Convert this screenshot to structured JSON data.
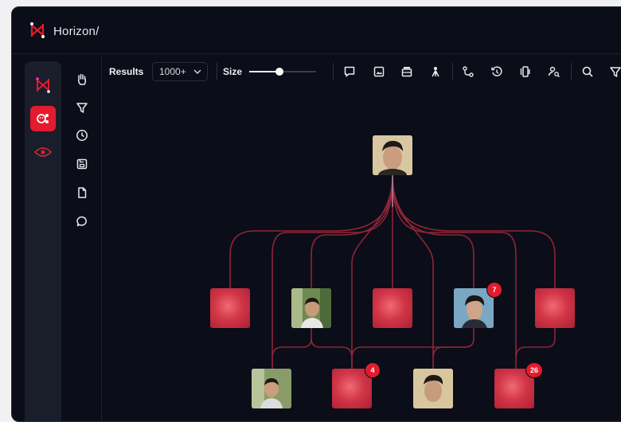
{
  "app": {
    "title": "Horizon/"
  },
  "toolbar": {
    "results_label": "Results",
    "results_value": "1000+",
    "size_label": "Size",
    "size_level": 0.45
  },
  "graph": {
    "badges": {
      "n7": "7",
      "n4": "4",
      "n26": "26"
    }
  },
  "colors": {
    "accent": "#e31b2c",
    "background": "#0b0d18",
    "edge": "#a3293d"
  }
}
